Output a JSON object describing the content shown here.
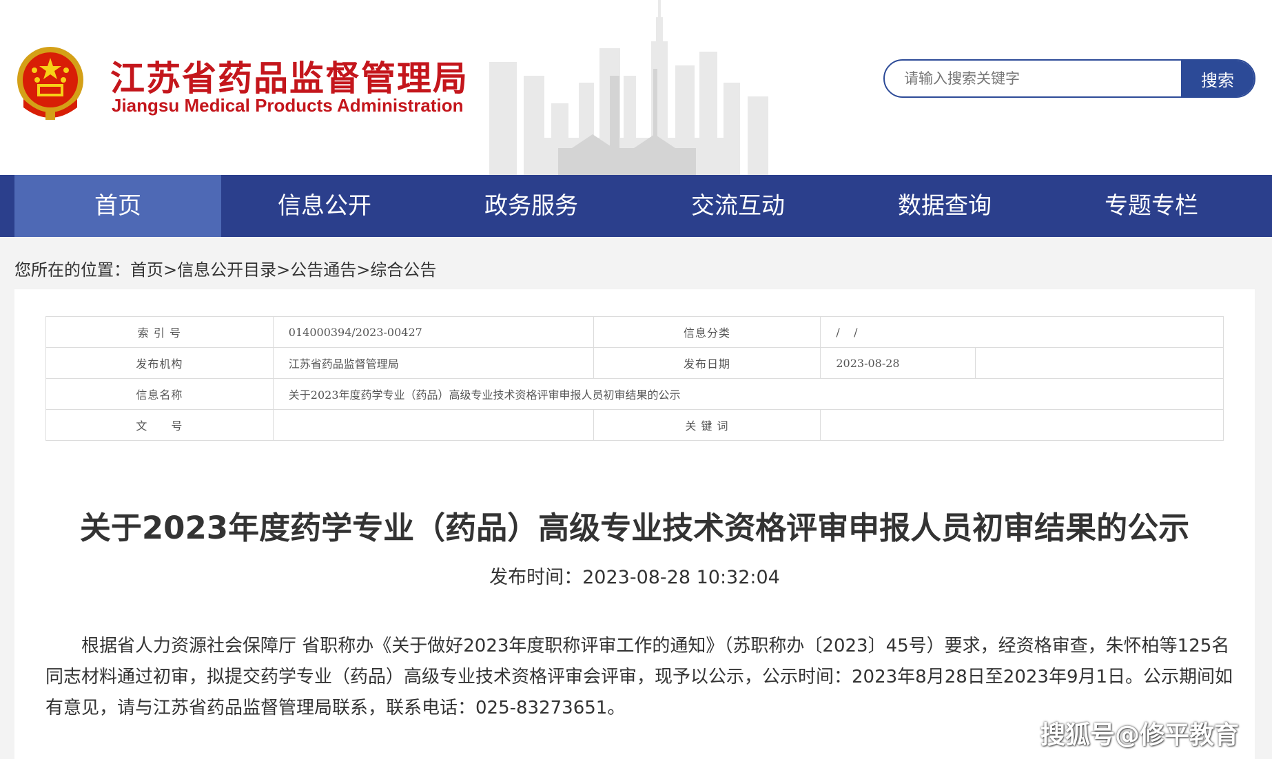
{
  "header": {
    "title_cn": "江苏省药品监督管理局",
    "title_en": "Jiangsu Medical Products Administration",
    "emblem_icon": "national-emblem-icon",
    "search": {
      "placeholder": "请输入搜索关键字",
      "button_label": "搜索"
    }
  },
  "nav": {
    "items": [
      {
        "label": "首页",
        "active": true
      },
      {
        "label": "信息公开"
      },
      {
        "label": "政务服务"
      },
      {
        "label": "交流互动"
      },
      {
        "label": "数据查询"
      },
      {
        "label": "专题专栏"
      }
    ]
  },
  "breadcrumb": {
    "prefix": "您所在的位置：",
    "items": [
      "首页",
      "信息公开目录",
      "公告通告",
      "综合公告"
    ],
    "separator": ">"
  },
  "meta": {
    "index_label": "索 引 号",
    "index_value": "014000394/2023-00427",
    "category_label": "信息分类",
    "category_value": "/    /",
    "org_label": "发布机构",
    "org_value": "江苏省药品监督管理局",
    "date_label": "发布日期",
    "date_value": "2023-08-28",
    "name_label": "信息名称",
    "name_value": "关于2023年度药学专业（药品）高级专业技术资格评审申报人员初审结果的公示",
    "docno_label": "文　　号",
    "docno_value": "",
    "keyword_label": "关 键 词",
    "keyword_value": ""
  },
  "article": {
    "title": "关于2023年度药学专业（药品）高级专业技术资格评审申报人员初审结果的公示",
    "pub_time": "发布时间：2023-08-28 10:32:04",
    "body": "根据省人力资源社会保障厅 省职称办《关于做好2023年度职称评审工作的通知》（苏职称办〔2023〕45号）要求，经资格审查，朱怀柏等125名同志材料通过初审，拟提交药学专业（药品）高级专业技术资格评审会评审，现予以公示，公示时间：2023年8月28日至2023年9月1日。公示期间如有意见，请与江苏省药品监督管理局联系，联系电话：025-83273651。"
  },
  "watermark": "搜狐号@修平教育",
  "colors": {
    "brand_red": "#c4161c",
    "nav_blue": "#2b3f8c",
    "nav_active": "#4e69b5",
    "search_blue": "#2c4a97"
  }
}
